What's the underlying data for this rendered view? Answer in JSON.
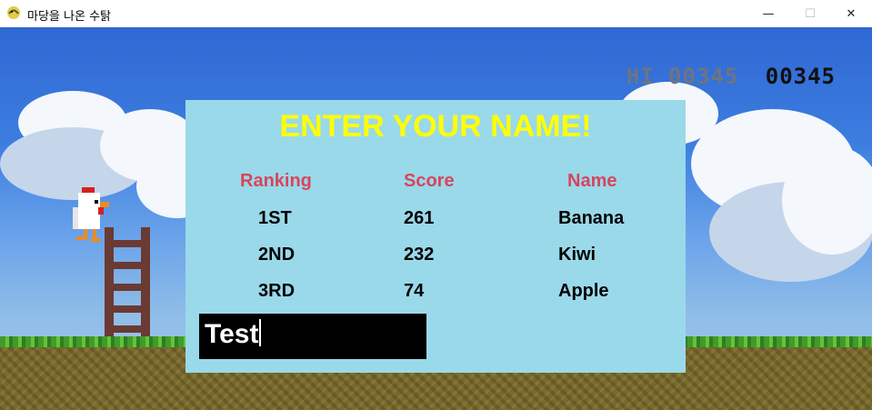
{
  "window": {
    "title": "마당을 나온 수탉",
    "minimize_glyph": "—",
    "maximize_glyph": "☐",
    "close_glyph": "✕"
  },
  "hud": {
    "hi_label": "HI",
    "hi_score": "00345",
    "current_score": "00345"
  },
  "dialog": {
    "title": "ENTER YOUR NAME!",
    "headers": {
      "ranking": "Ranking",
      "score": "Score",
      "name": "Name"
    },
    "rows": [
      {
        "rank": "1ST",
        "score": "261",
        "name": "Banana"
      },
      {
        "rank": "2ND",
        "score": "232",
        "name": "Kiwi"
      },
      {
        "rank": "3RD",
        "score": "74",
        "name": "Apple"
      }
    ],
    "name_input_value": "Test"
  },
  "colors": {
    "dialog_bg": "#9ad9ea",
    "title": "#ffff00",
    "header": "#d8455c",
    "input_bg": "#000000"
  },
  "icons": {
    "app": "pygame-snake-icon",
    "player": "chicken-sprite",
    "prop": "ladder"
  }
}
